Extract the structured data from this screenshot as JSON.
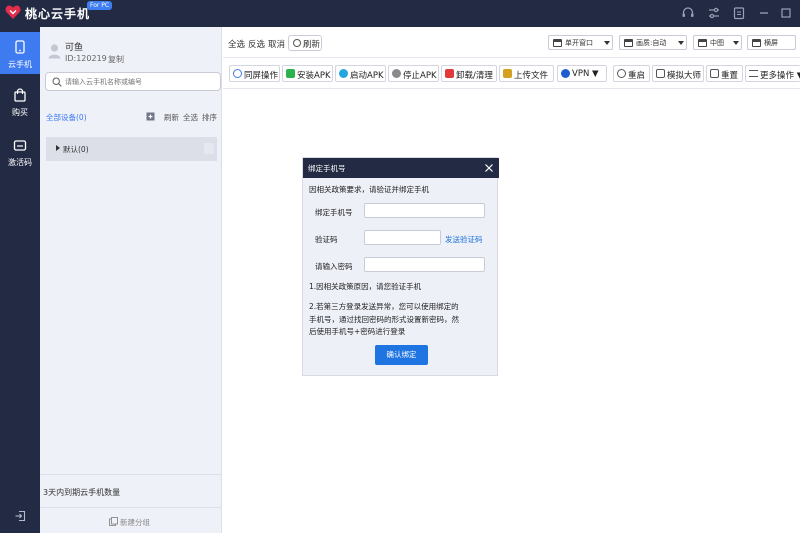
{
  "app": {
    "title": "桃心云手机",
    "badge": "For PC",
    "brand_color": "#e32d4a",
    "chrome_color": "#232a44",
    "accent": "#3e7af0"
  },
  "titlebar_icons": [
    "headset-icon",
    "settings-sliders-icon",
    "clipboard-icon",
    "minimize-icon",
    "maximize-icon"
  ],
  "rail": {
    "items": [
      {
        "label": "云手机",
        "icon": "phone-icon",
        "active": true
      },
      {
        "label": "购买",
        "icon": "shopping-bag-icon",
        "active": false
      },
      {
        "label": "激活码",
        "icon": "activation-code-icon",
        "active": false
      }
    ],
    "exit_icon": "exit-icon"
  },
  "panel": {
    "user_name": "可鱼",
    "user_id": "ID:120219",
    "copy": "复制",
    "search_placeholder": "请输入云手机名称或编号",
    "all_devices": "全部设备(0)",
    "actions": {
      "refresh": "刷新",
      "select_all": "全选",
      "sort": "排序"
    },
    "groups": [
      {
        "label": "默认(0)"
      }
    ],
    "expiring": "3天内到期云手机数量",
    "new_group": "新建分组"
  },
  "toolbar_top": {
    "select_all": "全选",
    "invert": "反选",
    "cancel": "取消",
    "refresh": "刷新",
    "window_mode": "单开窗口",
    "quality": "画质:自动",
    "size": "中图",
    "orientation": "横屏"
  },
  "toolbar_actions": [
    {
      "label": "同屏操作",
      "color": "#3e7af0"
    },
    {
      "label": "安装APK",
      "color": "#2bb24c"
    },
    {
      "label": "启动APK",
      "color": "#22a6e0"
    },
    {
      "label": "停止APK",
      "color": "#8a8a8a"
    },
    {
      "label": "卸载/清理",
      "color": "#e23a3a"
    },
    {
      "label": "上传文件",
      "color": "#d4a020"
    },
    {
      "label": "VPN ▼",
      "color": "#1e5fd0"
    },
    {
      "label": "重启",
      "color": "#555555"
    },
    {
      "label": "模拟大师",
      "color": "#555555"
    },
    {
      "label": "重置",
      "color": "#555555"
    },
    {
      "label": "更多操作 ▼",
      "color": "#555555"
    }
  ],
  "dialog": {
    "title": "绑定手机号",
    "intro": "因相关政策要求，请验证并绑定手机",
    "phone_label": "绑定手机号",
    "phone_value": "",
    "code_label": "验证码",
    "code_value": "",
    "send_code": "发送验证码",
    "password_label": "请输入密码",
    "password_value": "",
    "note1": "1.因相关政策原因，请您验证手机",
    "note2_line1": "2.若第三方登录发送异常，您可以使用绑定的",
    "note2_line2": "手机号，通过找回密码的形式设置新密码，然",
    "note2_line3": "后使用手机号+密码进行登录",
    "confirm": "确认绑定"
  }
}
